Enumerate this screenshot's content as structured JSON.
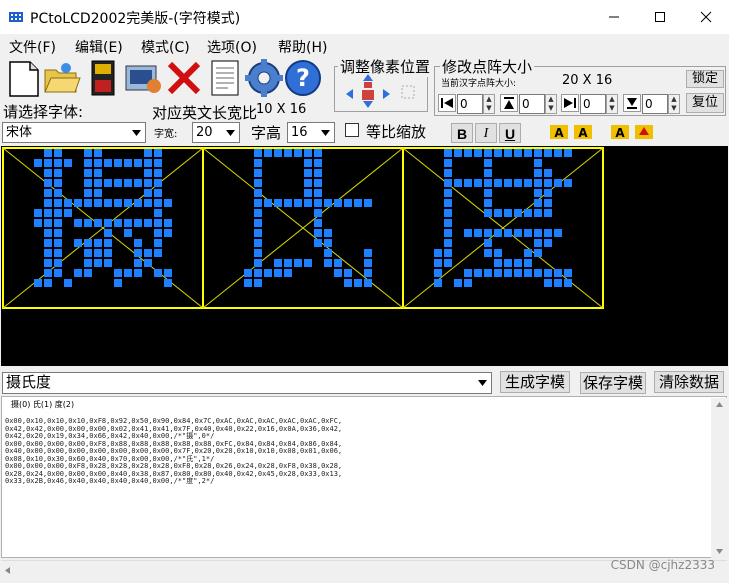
{
  "window": {
    "title": "PCtoLCD2002完美版-(字符模式)"
  },
  "menu": [
    "文件(F)",
    "编辑(E)",
    "模式(C)",
    "选项(O)",
    "帮助(H)"
  ],
  "toolbar_icons": [
    "new-icon",
    "open-icon",
    "save-icon",
    "settings-icon",
    "delete-icon",
    "document-icon",
    "options-gear-icon",
    "help-icon"
  ],
  "pixel_adjust": {
    "title": "调整像素位置"
  },
  "matrix_size": {
    "title": "修改点阵大小",
    "current_label": "当前汉字点阵大小:",
    "current_value": "20 X 16",
    "lock_label": "锁定",
    "reset_label": "复位",
    "spins": [
      "0",
      "0",
      "0",
      "0"
    ]
  },
  "font": {
    "select_label": "请选择字体:",
    "family": "宋体",
    "ratio_label": "对应英文长宽比",
    "ratio_value": "10 X 16",
    "width_label": "字宽:",
    "width_value": "20",
    "height_label": "字高",
    "height_value": "16",
    "scale_label": "等比缩放",
    "bold": "B",
    "italic": "I",
    "underline": "U"
  },
  "input": {
    "text": "摄氏度",
    "generate_label": "生成字模",
    "save_label": "保存字模",
    "clear_label": "清除数据"
  },
  "output": {
    "index_line": "摄(0) 氏(1) 度(2)",
    "lines": [
      "0x00,0x10,0x10,0x10,0xF8,0x92,0x50,0x90,0x84,0x7C,0xAC,0xAC,0xAC,0xAC,0xAC,0xFC,",
      "0x42,0x42,0x00,0x00,0x00,0x02,0x41,0x41,0x7F,0x40,0x40,0x22,0x16,0x0A,0x36,0x42,",
      "0x42,0x20,0x19,0x34,0x66,0x42,0x40,0x00,/*\"摄\",0*/",
      "0x00,0x00,0x00,0x00,0xF8,0x88,0x88,0x88,0x88,0x88,0xFC,0x84,0x84,0x84,0x86,0x84,",
      "0x40,0x00,0x00,0x00,0x00,0x00,0x00,0x00,0x7F,0x20,0x20,0x10,0x10,0x08,0x01,0x06,",
      "0x08,0x10,0x30,0x60,0x40,0x70,0x00,0x00,/*\"氏\",1*/",
      "0x00,0x00,0x00,0xF8,0x28,0x28,0x28,0x28,0xF8,0x28,0x26,0x24,0x28,0xF8,0x38,0x28,",
      "0x28,0x24,0x00,0x00,0x00,0x40,0x38,0x87,0x80,0x80,0x40,0x42,0x45,0x28,0x33,0x13,",
      "0x33,0x2B,0x46,0x40,0x40,0x40,0x40,0x00,/*\"度\",2*/"
    ]
  },
  "watermark": "CSDN @cjhz2333"
}
